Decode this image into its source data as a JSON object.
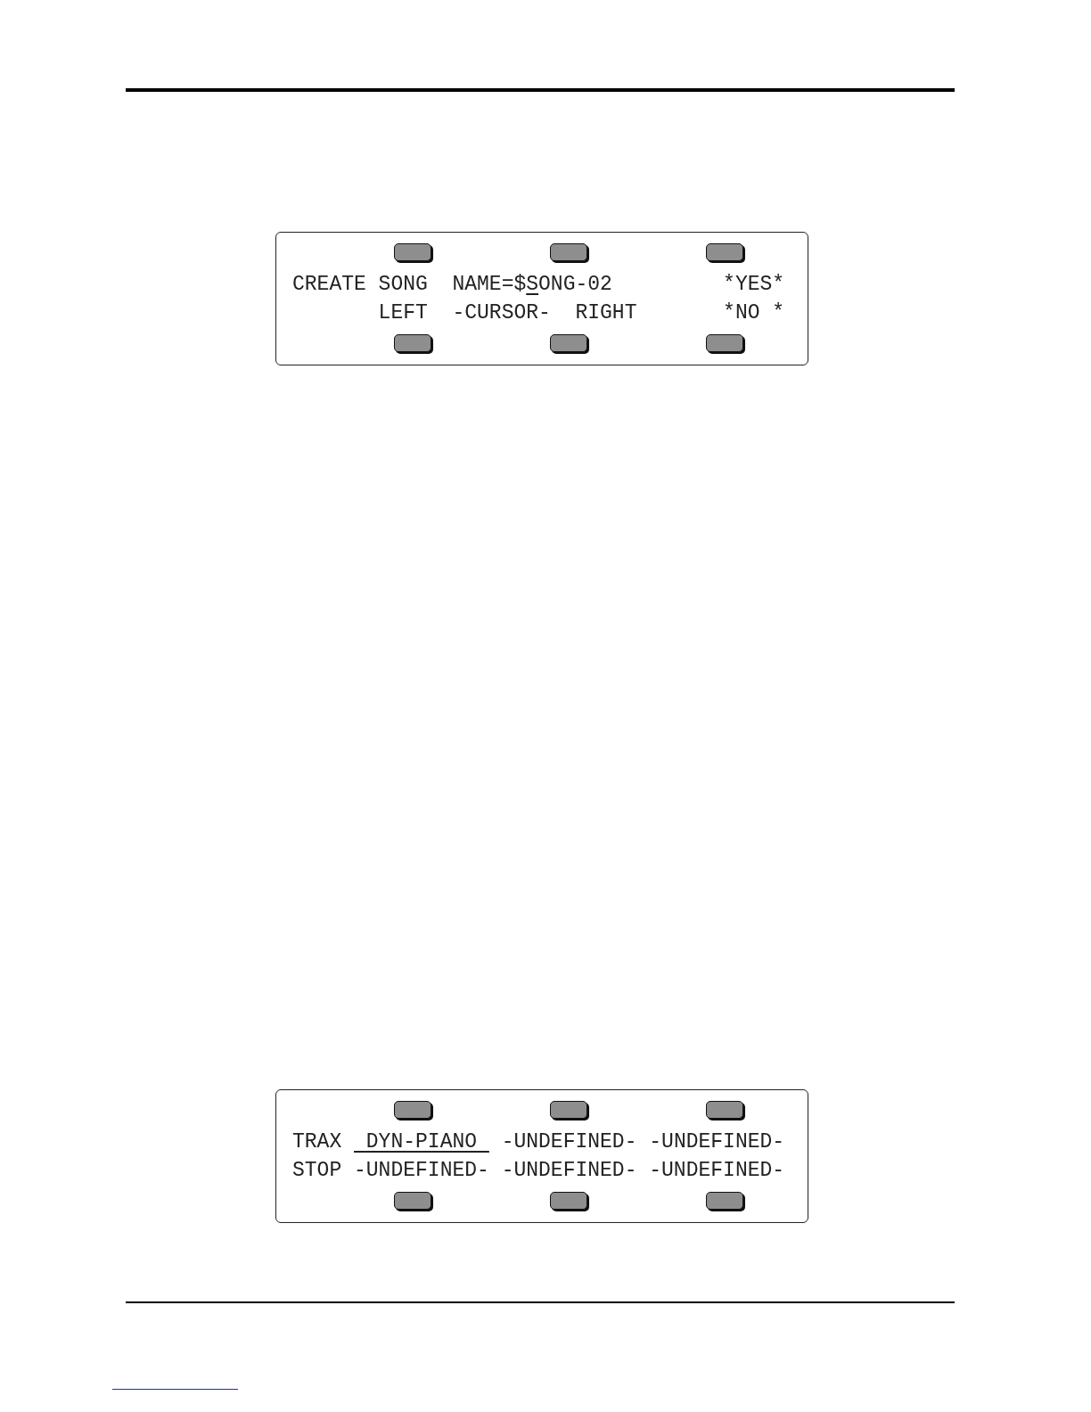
{
  "displays": [
    {
      "lines": [
        [
          {
            "text": "CREATE SONG  NAME=$",
            "underlined": false
          },
          {
            "text": "S",
            "underlined": true
          },
          {
            "text": "ONG-02         *YES*",
            "underlined": false
          }
        ],
        [
          {
            "text": "       LEFT  -CURSOR-  RIGHT       *NO *",
            "underlined": false
          }
        ]
      ]
    },
    {
      "lines": [
        [
          {
            "text": "TRAX ",
            "underlined": false
          },
          {
            "text": " DYN-PIANO ",
            "underlined": true
          },
          {
            "text": " -UNDEFINED- -UNDEFINED-",
            "underlined": false
          }
        ],
        [
          {
            "text": "STOP -UNDEFINED- -UNDEFINED- -UNDEFINED-",
            "underlined": false
          }
        ]
      ]
    }
  ]
}
